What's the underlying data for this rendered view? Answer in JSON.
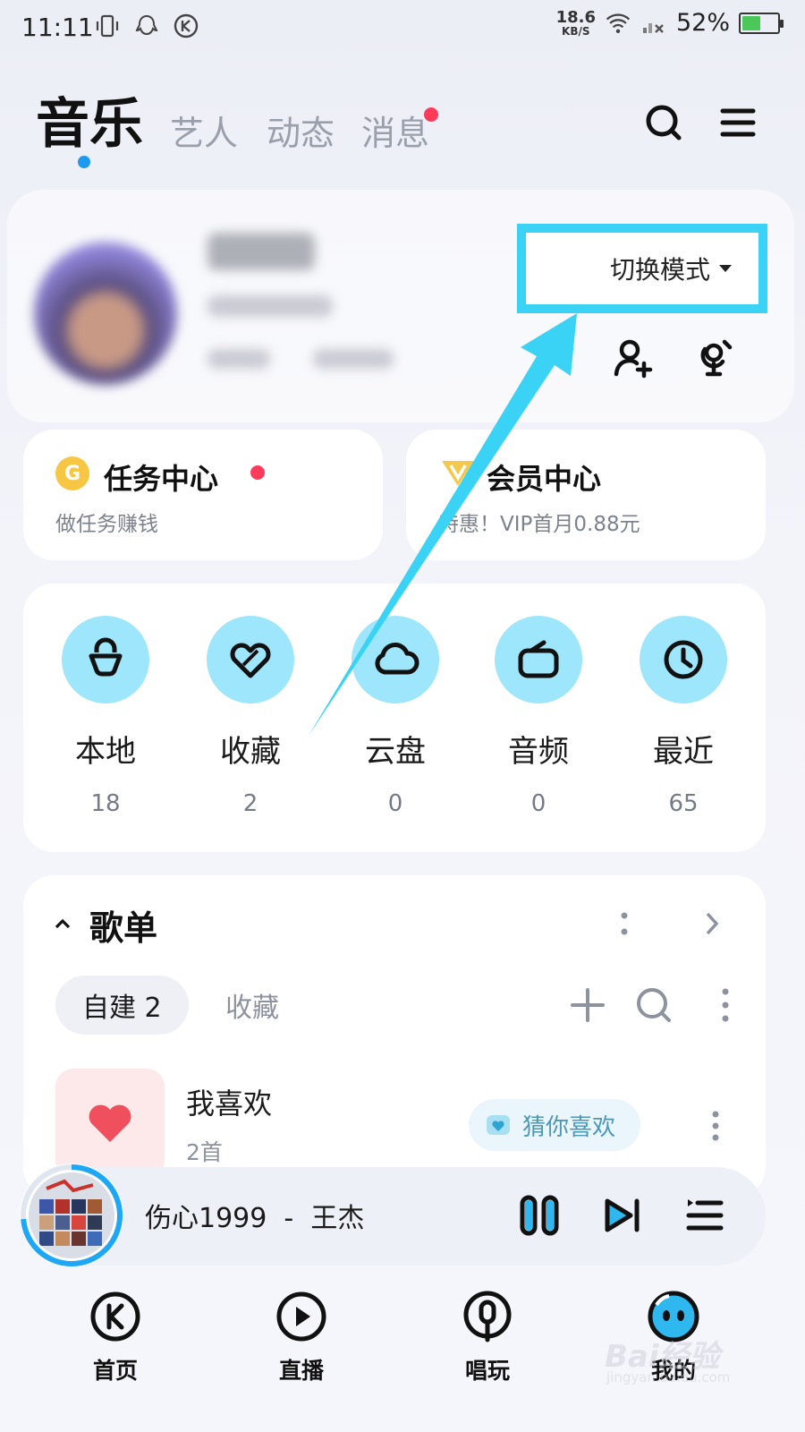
{
  "status_bar": {
    "time": "11:11",
    "net_speed_value": "18.6",
    "net_speed_unit": "KB/S",
    "battery": "52%",
    "battery_level": 0.52
  },
  "header": {
    "active_tab": "音乐",
    "tabs": [
      "艺人",
      "动态",
      "消息"
    ]
  },
  "profile": {
    "mode_switch": "切换模式"
  },
  "cards": {
    "task": {
      "title": "任务中心",
      "subtitle": "做任务赚钱",
      "icon": "G"
    },
    "vip": {
      "title": "会员中心",
      "subtitle": "特惠！VIP首月0.88元"
    }
  },
  "shortcuts": [
    {
      "label": "本地",
      "count": "18",
      "icon": "local-icon"
    },
    {
      "label": "收藏",
      "count": "2",
      "icon": "heart-outline-icon"
    },
    {
      "label": "云盘",
      "count": "0",
      "icon": "cloud-icon"
    },
    {
      "label": "音频",
      "count": "0",
      "icon": "radio-icon"
    },
    {
      "label": "最近",
      "count": "65",
      "icon": "clock-icon"
    }
  ],
  "playlist": {
    "title": "歌单",
    "tab_created": "自建 2",
    "tab_collected": "收藏",
    "rows": [
      {
        "title": "我喜欢",
        "subtitle": "2首",
        "action": "猜你喜欢"
      }
    ]
  },
  "player": {
    "now_playing": "伤心1999  -  王杰"
  },
  "bottom_nav": [
    {
      "label": "首页",
      "icon": "kugou-home-icon"
    },
    {
      "label": "直播",
      "icon": "live-play-icon"
    },
    {
      "label": "唱玩",
      "icon": "mic-icon"
    },
    {
      "label": "我的",
      "icon": "profile-face-icon"
    }
  ],
  "watermark": {
    "brand": "Bai经验",
    "url": "jingyan.baidu.com"
  },
  "colors": {
    "accent_blue": "#1e9bf0",
    "highlight_cyan": "#3ad3f5",
    "shortcut_bg": "#9ee6fb",
    "badge_red": "#ff3b5c"
  }
}
